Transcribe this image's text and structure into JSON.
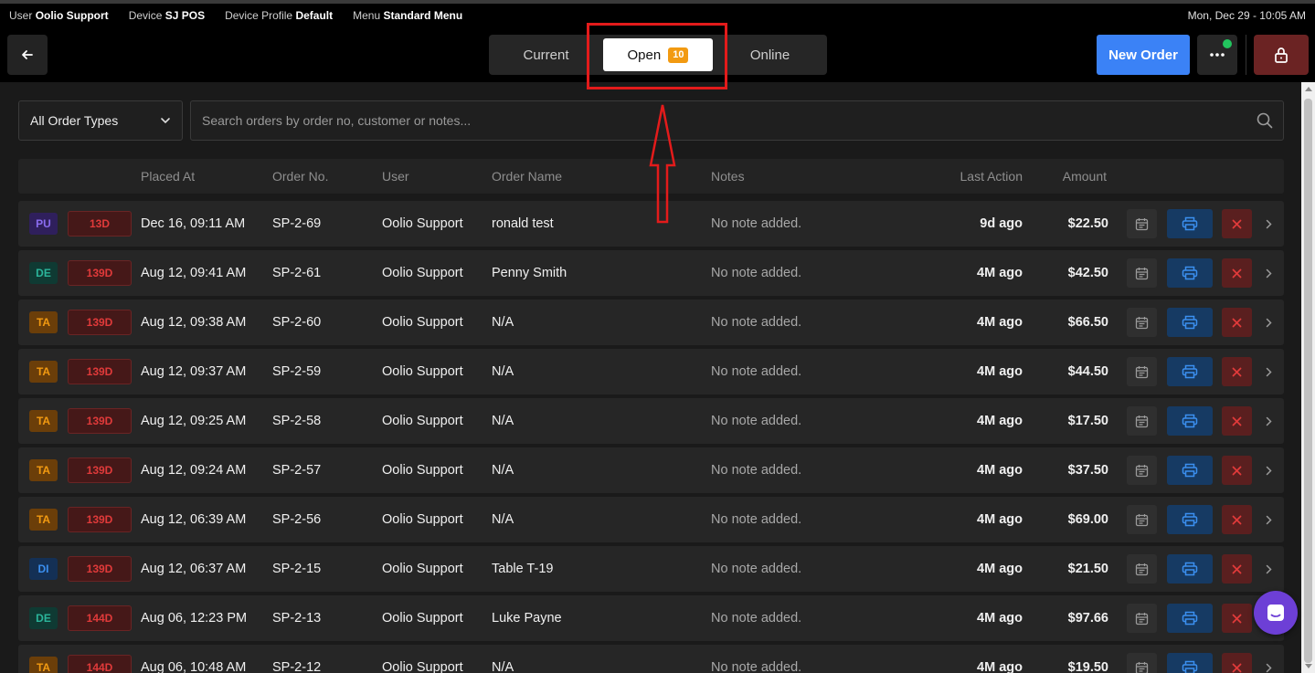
{
  "status_bar": {
    "user_label": "User",
    "user_value": "Oolio Support",
    "device_label": "Device",
    "device_value": "SJ POS",
    "profile_label": "Device Profile",
    "profile_value": "Default",
    "menu_label": "Menu",
    "menu_value": "Standard Menu",
    "datetime": "Mon, Dec 29 - 10:05 AM"
  },
  "header": {
    "tabs": [
      {
        "label": "Current"
      },
      {
        "label": "Open",
        "badge": "10",
        "active": true
      },
      {
        "label": "Online"
      }
    ],
    "new_order_label": "New Order"
  },
  "filters": {
    "order_type": "All Order Types",
    "search_placeholder": "Search orders by order no, customer or notes..."
  },
  "table": {
    "columns": {
      "placed_at": "Placed At",
      "order_no": "Order No.",
      "user": "User",
      "order_name": "Order Name",
      "notes": "Notes",
      "last_action": "Last Action",
      "amount": "Amount"
    },
    "rows": [
      {
        "type": "PU",
        "age": "13D",
        "placed_at": "Dec 16, 09:11 AM",
        "order_no": "SP-2-69",
        "user": "Oolio Support",
        "order_name": "ronald test",
        "notes": "No note added.",
        "last_action": "9d ago",
        "amount": "$22.50"
      },
      {
        "type": "DE",
        "age": "139D",
        "placed_at": "Aug 12, 09:41 AM",
        "order_no": "SP-2-61",
        "user": "Oolio Support",
        "order_name": "Penny Smith",
        "notes": "No note added.",
        "last_action": "4M ago",
        "amount": "$42.50"
      },
      {
        "type": "TA",
        "age": "139D",
        "placed_at": "Aug 12, 09:38 AM",
        "order_no": "SP-2-60",
        "user": "Oolio Support",
        "order_name": "N/A",
        "notes": "No note added.",
        "last_action": "4M ago",
        "amount": "$66.50"
      },
      {
        "type": "TA",
        "age": "139D",
        "placed_at": "Aug 12, 09:37 AM",
        "order_no": "SP-2-59",
        "user": "Oolio Support",
        "order_name": "N/A",
        "notes": "No note added.",
        "last_action": "4M ago",
        "amount": "$44.50"
      },
      {
        "type": "TA",
        "age": "139D",
        "placed_at": "Aug 12, 09:25 AM",
        "order_no": "SP-2-58",
        "user": "Oolio Support",
        "order_name": "N/A",
        "notes": "No note added.",
        "last_action": "4M ago",
        "amount": "$17.50"
      },
      {
        "type": "TA",
        "age": "139D",
        "placed_at": "Aug 12, 09:24 AM",
        "order_no": "SP-2-57",
        "user": "Oolio Support",
        "order_name": "N/A",
        "notes": "No note added.",
        "last_action": "4M ago",
        "amount": "$37.50"
      },
      {
        "type": "TA",
        "age": "139D",
        "placed_at": "Aug 12, 06:39 AM",
        "order_no": "SP-2-56",
        "user": "Oolio Support",
        "order_name": "N/A",
        "notes": "No note added.",
        "last_action": "4M ago",
        "amount": "$69.00"
      },
      {
        "type": "DI",
        "age": "139D",
        "placed_at": "Aug 12, 06:37 AM",
        "order_no": "SP-2-15",
        "user": "Oolio Support",
        "order_name": "Table T-19",
        "notes": "No note added.",
        "last_action": "4M ago",
        "amount": "$21.50"
      },
      {
        "type": "DE",
        "age": "144D",
        "placed_at": "Aug 06, 12:23 PM",
        "order_no": "SP-2-13",
        "user": "Oolio Support",
        "order_name": "Luke Payne",
        "notes": "No note added.",
        "last_action": "4M ago",
        "amount": "$97.66"
      },
      {
        "type": "TA",
        "age": "144D",
        "placed_at": "Aug 06, 10:48 AM",
        "order_no": "SP-2-12",
        "user": "Oolio Support",
        "order_name": "N/A",
        "notes": "No note added.",
        "last_action": "4M ago",
        "amount": "$19.50"
      }
    ]
  },
  "icons": {
    "back": "arrow-left-icon",
    "more": "more-horizontal-icon",
    "lock": "lock-icon",
    "search": "search-icon",
    "calendar": "calendar-icon",
    "print": "printer-icon",
    "delete": "close-icon",
    "open_row": "chevron-right-icon",
    "chat": "chat-icon"
  },
  "colors": {
    "accent_blue": "#3b82f6",
    "badge_orange": "#f29a11",
    "annotation_red": "#e31b1b",
    "online_green": "#22c55e",
    "chat_purple": "#6d3fd6"
  }
}
